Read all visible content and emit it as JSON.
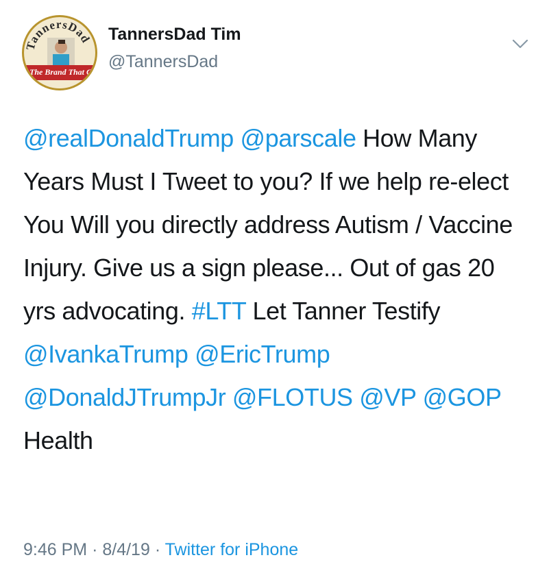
{
  "header": {
    "display_name": "TannersDad Tim",
    "handle": "@TannersDad",
    "avatar_ring_text": "TannersDad",
    "avatar_banner_text": "The Brand That Ca"
  },
  "tweet": {
    "seg1": "@realDonaldTrump",
    "seg2": "@parscale",
    "seg3": " How Many Years Must I Tweet to you? If we help re-elect You Will you directly address Autism / Vaccine Injury. Give us a sign please... Out of gas 20 yrs advocating. ",
    "seg4": "#LTT",
    "seg5": " Let Tanner Testify ",
    "seg6": "@IvankaTrump",
    "seg7": "@EricTrump",
    "seg8": "@DonaldJTrumpJr",
    "seg9": "@FLOTUS",
    "seg10": "@VP",
    "seg11": "@GOP",
    "seg12": " Health"
  },
  "meta": {
    "time": "9:46 PM",
    "date": "8/4/19",
    "separator": "·",
    "source": "Twitter for iPhone"
  },
  "colors": {
    "link": "#1b95e0",
    "secondary_text": "#657786",
    "primary_text": "#14171a"
  },
  "icons": {
    "menu": "chevron-down-icon"
  }
}
